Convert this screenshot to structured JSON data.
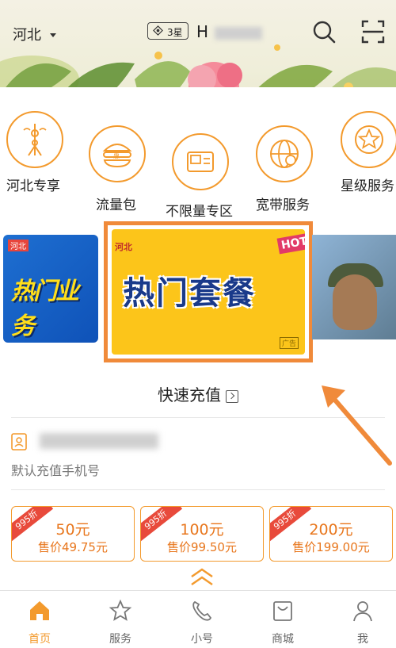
{
  "header": {
    "region": "河北",
    "star_level": "3星",
    "phone_prefix": "H",
    "search_icon": "search-icon",
    "scan_icon": "scan-icon"
  },
  "entries": [
    {
      "label": "河北专享",
      "icon": "tower-icon"
    },
    {
      "label": "流量包",
      "icon": "burger-icon"
    },
    {
      "label": "不限量专区",
      "icon": "sim-card-icon"
    },
    {
      "label": "宽带服务",
      "icon": "globe-icon"
    },
    {
      "label": "星级服务",
      "icon": "star-icon"
    }
  ],
  "carousel": {
    "left_card_title": "热门业务",
    "left_card_tag": "河北",
    "main_card_title": "热门套餐",
    "main_card_badge": "HOT",
    "main_card_tag": "河北",
    "main_card_ad": "广告"
  },
  "topup": {
    "title": "快速充值",
    "hint": "默认充值手机号",
    "packages": [
      {
        "discount": "995折",
        "amount": "50元",
        "price": "售价49.75元"
      },
      {
        "discount": "995折",
        "amount": "100元",
        "price": "售价99.50元"
      },
      {
        "discount": "995折",
        "amount": "200元",
        "price": "售价199.00元"
      }
    ]
  },
  "tabbar": [
    {
      "label": "首页",
      "icon": "home-icon",
      "active": true
    },
    {
      "label": "服务",
      "icon": "star-outline-icon",
      "active": false
    },
    {
      "label": "小号",
      "icon": "phone-icon",
      "active": false
    },
    {
      "label": "商城",
      "icon": "bag-icon",
      "active": false
    },
    {
      "label": "我",
      "icon": "user-icon",
      "active": false
    }
  ],
  "colors": {
    "accent": "#f39a2d",
    "highlight_border": "#f08a3a",
    "discount_ribbon": "#e84a3b"
  }
}
